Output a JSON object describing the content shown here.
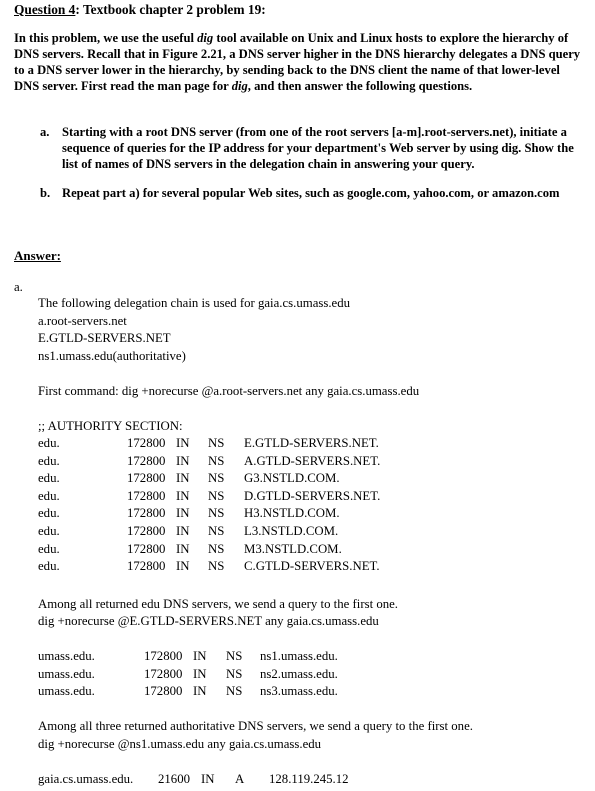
{
  "question": {
    "number_label": "Question 4",
    "title_rest": ": Textbook chapter 2 problem 19:",
    "intro": [
      "In this problem, we use the useful ",
      "dig",
      " tool available on Unix and Linux hosts to        explore the hierarchy of DNS servers.  Recall that in Figure 2.21, a DNS server higher in the DNS hierarchy delegates a DNS query to a DNS server lower in the hierarchy, by sending back to the DNS client the name of that lower-level DNS server.  First read the man page for ",
      "dig",
      ", and then answer the following questions."
    ],
    "parts": [
      {
        "label": "a.",
        "text": "Starting with a root DNS server (from one of the root servers [a-m].root-servers.net), initiate a sequence of queries for the IP address for your department's Web server by using dig.  Show the list of names of DNS servers in the delegation chain in answering your query."
      },
      {
        "label": "b.",
        "text": "Repeat part a) for several popular Web sites, such as google.com, yahoo.com, or amazon.com"
      }
    ]
  },
  "answer": {
    "heading": "Answer:",
    "part_label": "a.",
    "chain_intro": "The following delegation chain is used for gaia.cs.umass.edu",
    "chain": [
      "a.root-servers.net",
      "E.GTLD-SERVERS.NET",
      "ns1.umass.edu(authoritative)"
    ],
    "first_command": "First command: dig +norecurse @a.root-servers.net any gaia.cs.umass.edu",
    "authority_header": ";; AUTHORITY SECTION:",
    "edu_records": [
      [
        "edu.",
        "172800",
        "IN",
        "NS",
        "E.GTLD-SERVERS.NET."
      ],
      [
        "edu.",
        "172800",
        "IN",
        "NS",
        "A.GTLD-SERVERS.NET."
      ],
      [
        "edu.",
        "172800",
        "IN",
        "NS",
        "G3.NSTLD.COM."
      ],
      [
        "edu.",
        "172800",
        "IN",
        "NS",
        "D.GTLD-SERVERS.NET."
      ],
      [
        "edu.",
        "172800",
        "IN",
        "NS",
        "H3.NSTLD.COM."
      ],
      [
        "edu.",
        "172800",
        "IN",
        "NS",
        "L3.NSTLD.COM."
      ],
      [
        "edu.",
        "172800",
        "IN",
        "NS",
        "M3.NSTLD.COM."
      ],
      [
        "edu.",
        "172800",
        "IN",
        "NS",
        "C.GTLD-SERVERS.NET."
      ]
    ],
    "second_note": "Among all returned edu DNS servers, we send a query to the first one.",
    "second_command": "dig +norecurse @E.GTLD-SERVERS.NET any gaia.cs.umass.edu",
    "umass_records": [
      [
        "umass.edu.",
        "172800",
        "IN",
        "NS",
        "ns1.umass.edu."
      ],
      [
        "umass.edu.",
        "172800",
        "IN",
        "NS",
        "ns2.umass.edu."
      ],
      [
        "umass.edu.",
        "172800",
        "IN",
        "NS",
        "ns3.umass.edu."
      ]
    ],
    "third_note": "Among all three returned authoritative DNS servers, we send a query to the first one.",
    "third_command": "dig +norecurse @ns1.umass.edu any gaia.cs.umass.edu",
    "final_record": [
      "gaia.cs.umass.edu.",
      "21600",
      "IN",
      "A",
      "128.119.245.12"
    ]
  }
}
